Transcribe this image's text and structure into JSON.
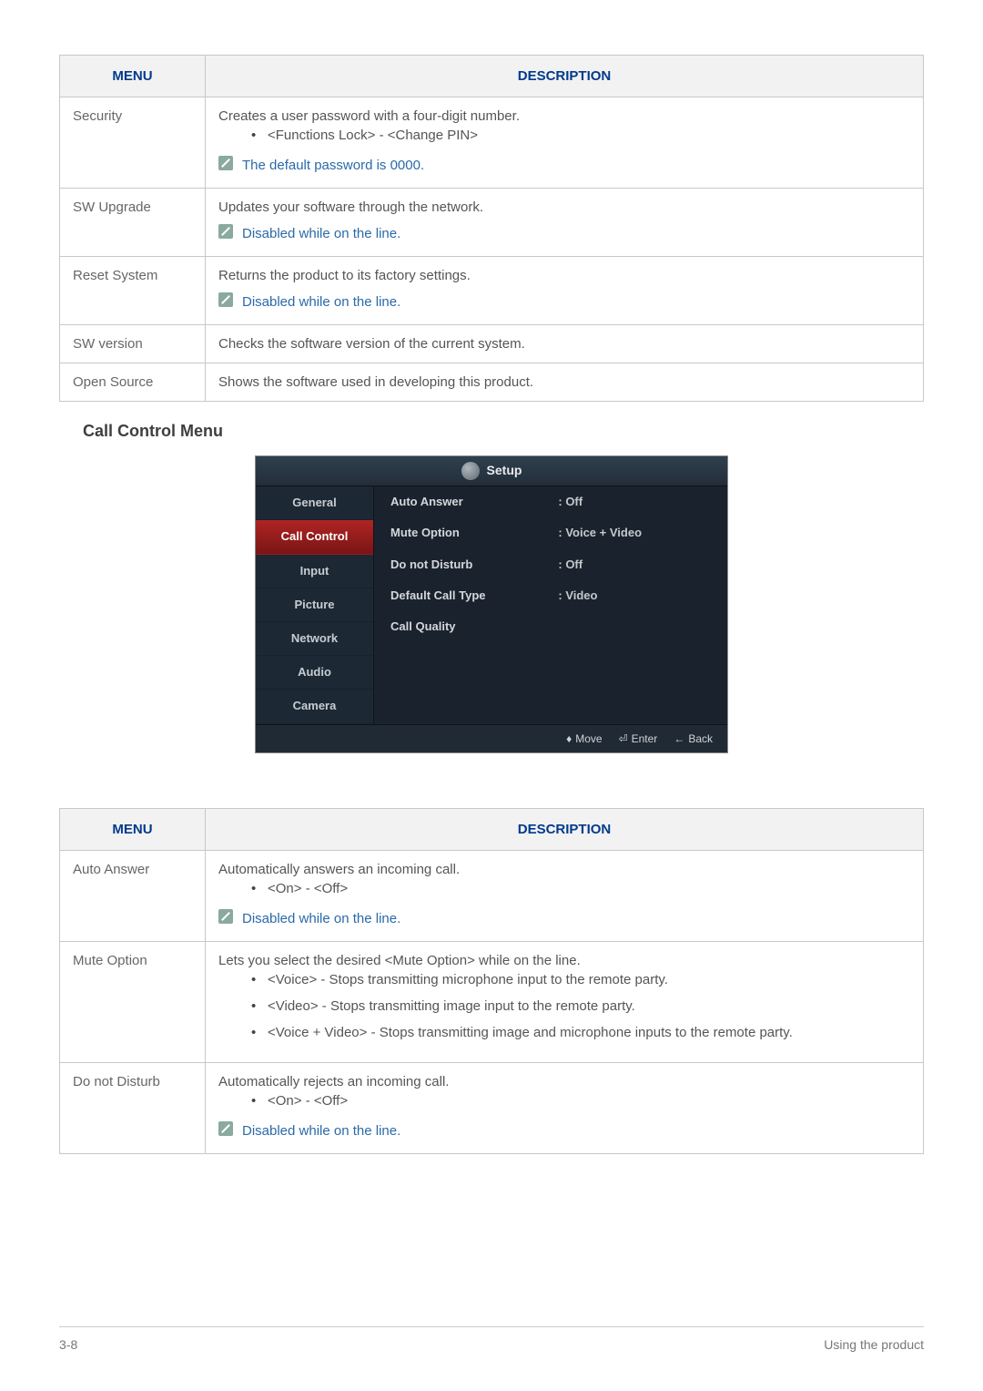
{
  "table1": {
    "headers": {
      "menu": "MENU",
      "description": "DESCRIPTION"
    },
    "rows": [
      {
        "menu": "Security",
        "desc": "Creates a user password with a four-digit number.",
        "bullets": [
          "<Functions Lock> - <Change PIN>"
        ],
        "note": "The default password is 0000."
      },
      {
        "menu": "SW Upgrade",
        "desc": "Updates your software through the network.",
        "note": "Disabled while on the line."
      },
      {
        "menu": "Reset System",
        "desc": "Returns the product to its factory settings.",
        "note": "Disabled while on the line."
      },
      {
        "menu": "SW version",
        "desc": "Checks the software version of the current system."
      },
      {
        "menu": "Open Source",
        "desc": "Shows the software used in developing this product."
      }
    ]
  },
  "section_title": "Call Control Menu",
  "osd": {
    "title": "Setup",
    "tabs": [
      "General",
      "Call Control",
      "Input",
      "Picture",
      "Network",
      "Audio",
      "Camera"
    ],
    "active_tab_index": 1,
    "items": [
      {
        "label": "Auto Answer",
        "value": ": Off"
      },
      {
        "label": "Mute Option",
        "value": ": Voice + Video"
      },
      {
        "label": "Do not Disturb",
        "value": ": Off"
      },
      {
        "label": "Default Call Type",
        "value": ": Video"
      },
      {
        "label": "Call Quality",
        "value": ""
      }
    ],
    "footer": {
      "move": "Move",
      "enter": "Enter",
      "back": "Back"
    }
  },
  "table2": {
    "headers": {
      "menu": "MENU",
      "description": "DESCRIPTION"
    },
    "rows": [
      {
        "menu": "Auto Answer",
        "desc": "Automatically answers an incoming call.",
        "bullets": [
          "<On> - <Off>"
        ],
        "note": "Disabled while on the line."
      },
      {
        "menu": "Mute Option",
        "desc": "Lets you select the desired <Mute Option> while on the line.",
        "bullets": [
          "<Voice> - Stops transmitting microphone input to the remote party.",
          "<Video> - Stops transmitting image input to the remote party.",
          "<Voice + Video> - Stops transmitting image and microphone inputs to the remote party."
        ]
      },
      {
        "menu": "Do not Disturb",
        "desc": "Automatically rejects an incoming call.",
        "bullets": [
          "<On> - <Off>"
        ],
        "note": "Disabled while on the line."
      }
    ]
  },
  "footer": {
    "page": "3-8",
    "section": "Using the product"
  }
}
